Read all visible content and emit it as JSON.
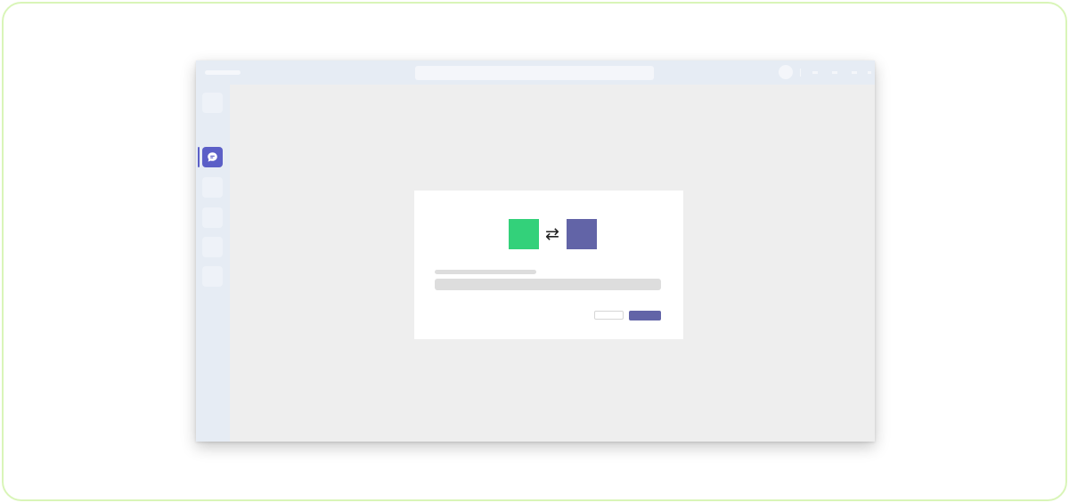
{
  "colors": {
    "frame_border": "#d9f5b8",
    "titlebar": "#e6ecf4",
    "canvas": "#eeeeee",
    "accent": "#5b5fc7",
    "app_green": "#33d17a",
    "app_purple": "#6264a7"
  },
  "window": {
    "title": "",
    "search": {
      "value": "",
      "placeholder": ""
    }
  },
  "sidebar": {
    "items": [
      {
        "icon": "activity-icon",
        "active": false
      },
      {
        "icon": "chat-icon",
        "active": true
      },
      {
        "icon": "teams-icon",
        "active": false
      },
      {
        "icon": "calendar-icon",
        "active": false
      },
      {
        "icon": "calls-icon",
        "active": false
      },
      {
        "icon": "files-icon",
        "active": false
      }
    ]
  },
  "dialog": {
    "source_app_icon": "green-app-icon",
    "connection_icon": "swap-arrows-icon",
    "target_app_icon": "purple-app-icon",
    "swap_glyph": "⇄",
    "heading": "",
    "description": "",
    "cancel_label": "",
    "confirm_label": ""
  }
}
